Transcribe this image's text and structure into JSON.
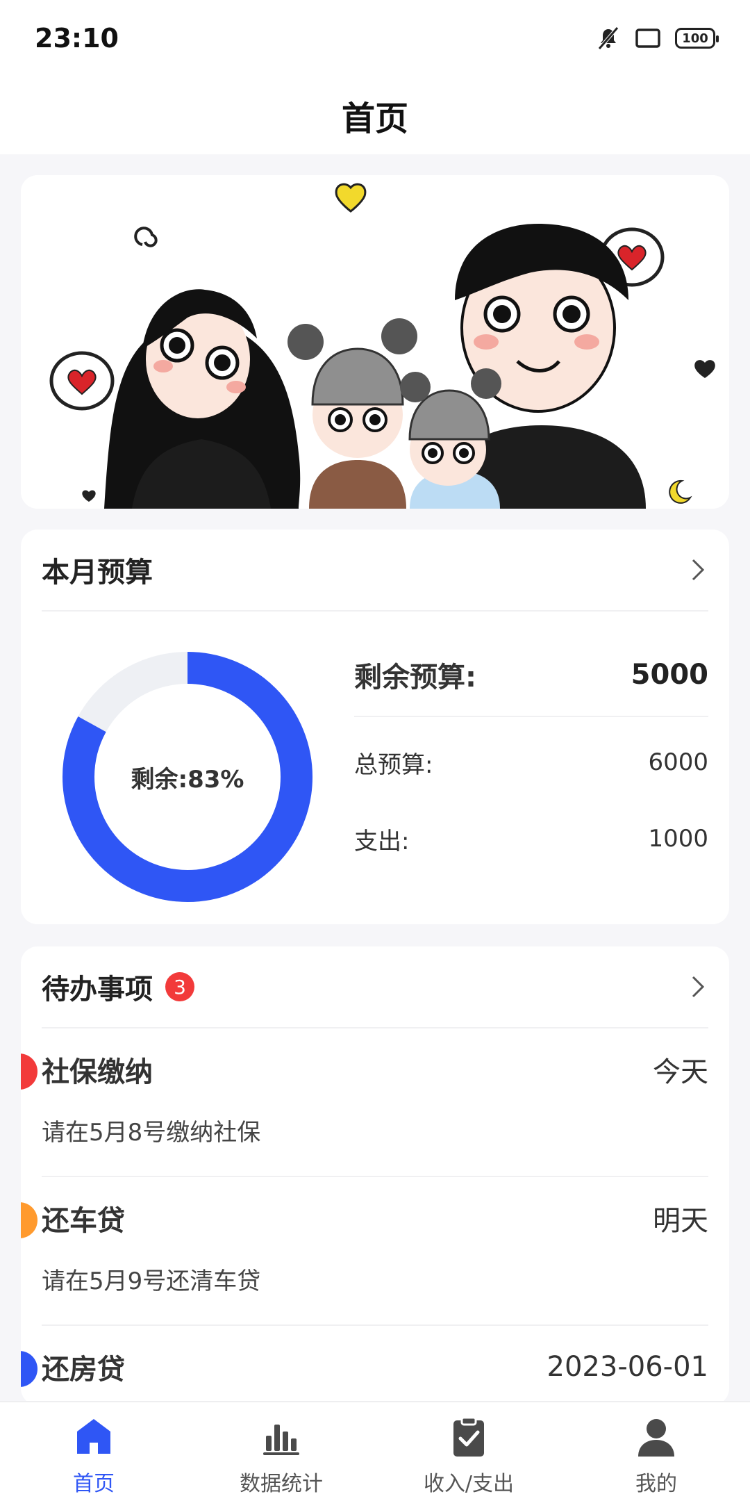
{
  "status_bar": {
    "time": "23:10",
    "battery": "100"
  },
  "header": {
    "title": "首页"
  },
  "budget": {
    "title": "本月预算",
    "remaining_label": "剩余预算:",
    "remaining_value": "5000",
    "ring_label": "剩余:83%",
    "remaining_fraction": 0.83,
    "total_label": "总预算:",
    "total_value": "6000",
    "expense_label": "支出:",
    "expense_value": "1000",
    "ring_color": "#2f56f5",
    "ring_track_color": "#eef0f4"
  },
  "todo": {
    "title": "待办事项",
    "badge_count": "3",
    "items": [
      {
        "title": "社保缴纳",
        "when": "今天",
        "desc": "请在5月8号缴纳社保",
        "color": "#f23a3a"
      },
      {
        "title": "还车贷",
        "when": "明天",
        "desc": "请在5月9号还清车贷",
        "color": "#ff9a2e"
      },
      {
        "title": "还房贷",
        "when": "2023-06-01",
        "desc": "",
        "color": "#2f56f5"
      }
    ]
  },
  "tabs": [
    {
      "label": "首页",
      "icon": "home-icon",
      "active": true
    },
    {
      "label": "数据统计",
      "icon": "bar-chart-icon",
      "active": false
    },
    {
      "label": "收入/支出",
      "icon": "clipboard-check-icon",
      "active": false
    },
    {
      "label": "我的",
      "icon": "user-icon",
      "active": false
    }
  ],
  "colors": {
    "accent": "#2f56f5",
    "inactive_icon": "#4a4a4a"
  }
}
